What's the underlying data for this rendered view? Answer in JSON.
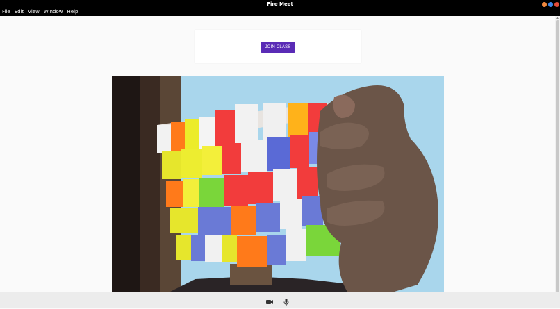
{
  "window": {
    "title": "Fire Meet",
    "controls": [
      {
        "name": "minimize",
        "color": "#f0883e"
      },
      {
        "name": "maximize",
        "color": "#3e87e8"
      },
      {
        "name": "close",
        "color": "#e44d3a"
      }
    ]
  },
  "menu": {
    "items": [
      "File",
      "Edit",
      "View",
      "Window",
      "Help"
    ]
  },
  "join": {
    "label": "JOIN CLASS",
    "color": "#5a2bb6"
  },
  "video": {
    "description_icon": "camera-feed"
  },
  "controls": {
    "camera_icon": "video-camera-icon",
    "mic_icon": "microphone-icon"
  }
}
